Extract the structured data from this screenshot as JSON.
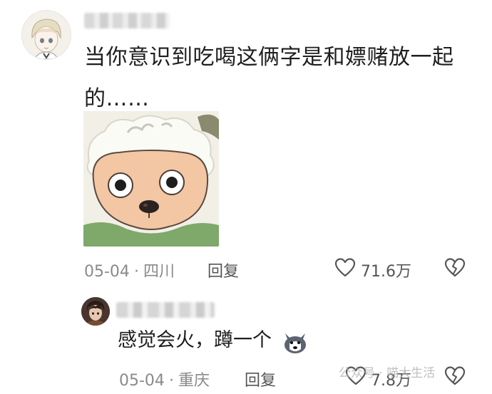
{
  "comment1": {
    "text": "当你意识到吃喝这俩字是和嫖赌放一起的……",
    "date": "05-04",
    "location": "四川",
    "reply_label": "回复",
    "likes": "71.6万"
  },
  "comment2": {
    "text": "感觉会火，蹲一个",
    "date": "05-04",
    "location": "重庆",
    "reply_label": "回复",
    "likes": "7.8万"
  },
  "watermark": "公众号 · 喵大生活",
  "icons": {
    "like": "heart-outline-icon",
    "dislike": "broken-heart-icon",
    "emoji": "husky-emoji-icon"
  },
  "colors": {
    "meta": "#8a8a8a",
    "text": "#1e1e1e"
  }
}
